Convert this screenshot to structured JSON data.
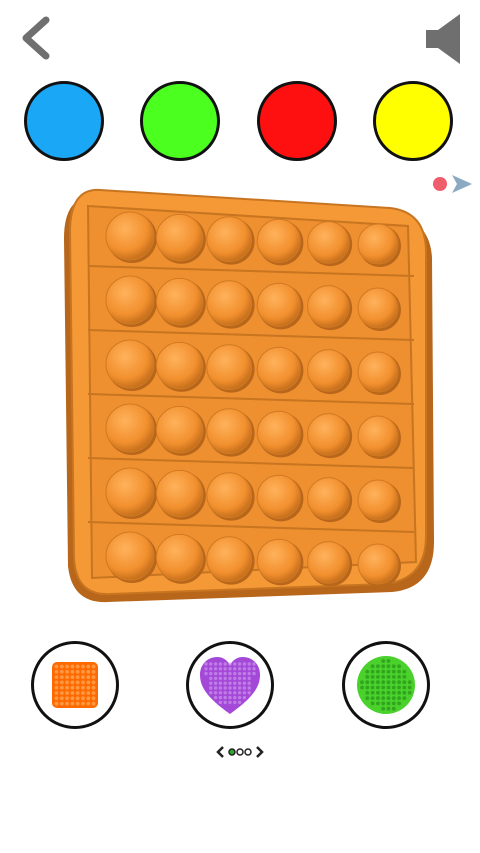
{
  "top_bar": {
    "back_icon": "chevron-left-icon",
    "sound_icon": "speaker-icon"
  },
  "colors": {
    "palette": [
      "#1aa7f5",
      "#4bff1e",
      "#ff1010",
      "#ffff00"
    ],
    "board_color": "#f59836",
    "record_dot": "#ef5c6c",
    "play_arrow": "#8aa9c2"
  },
  "board": {
    "rows": 6,
    "cols": 6
  },
  "shapes": [
    {
      "name": "square",
      "color": "#ff6a00"
    },
    {
      "name": "heart",
      "color": "#a448d8"
    },
    {
      "name": "circle",
      "color": "#4ad12c"
    }
  ],
  "pager": {
    "pages": 3,
    "current": 0
  }
}
